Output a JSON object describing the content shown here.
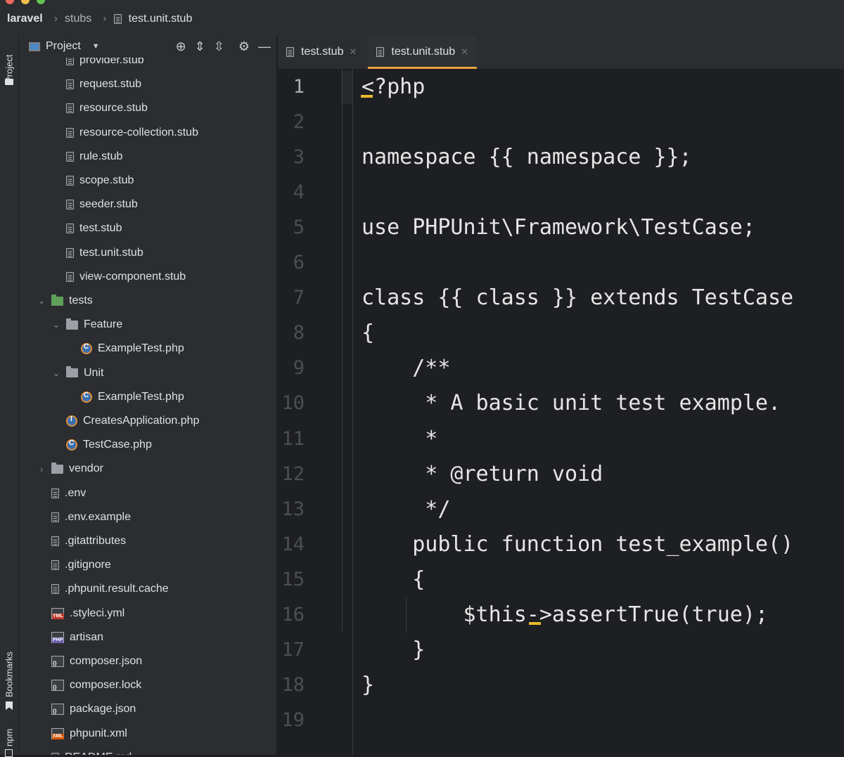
{
  "breadcrumb": {
    "root": "laravel",
    "folder": "stubs",
    "file": "test.unit.stub"
  },
  "sidebar_strip": {
    "project": "Project",
    "bookmarks": "Bookmarks",
    "npm": "npm"
  },
  "panel": {
    "title": "Project"
  },
  "tree": [
    {
      "label": "provider.stub",
      "indent": 2,
      "icon": "file"
    },
    {
      "label": "request.stub",
      "indent": 2,
      "icon": "file"
    },
    {
      "label": "resource.stub",
      "indent": 2,
      "icon": "file"
    },
    {
      "label": "resource-collection.stub",
      "indent": 2,
      "icon": "file"
    },
    {
      "label": "rule.stub",
      "indent": 2,
      "icon": "file"
    },
    {
      "label": "scope.stub",
      "indent": 2,
      "icon": "file"
    },
    {
      "label": "seeder.stub",
      "indent": 2,
      "icon": "file"
    },
    {
      "label": "test.stub",
      "indent": 2,
      "icon": "file"
    },
    {
      "label": "test.unit.stub",
      "indent": 2,
      "icon": "file"
    },
    {
      "label": "view-component.stub",
      "indent": 2,
      "icon": "file"
    },
    {
      "label": "tests",
      "indent": 1,
      "icon": "folder-green",
      "chevron": "down"
    },
    {
      "label": "Feature",
      "indent": 2,
      "icon": "folder",
      "chevron": "down"
    },
    {
      "label": "ExampleTest.php",
      "indent": 3,
      "icon": "php-class"
    },
    {
      "label": "Unit",
      "indent": 2,
      "icon": "folder",
      "chevron": "down"
    },
    {
      "label": "ExampleTest.php",
      "indent": 3,
      "icon": "php-class"
    },
    {
      "label": "CreatesApplication.php",
      "indent": 2,
      "icon": "php-interface"
    },
    {
      "label": "TestCase.php",
      "indent": 2,
      "icon": "php-class"
    },
    {
      "label": "vendor",
      "indent": 1,
      "icon": "folder",
      "chevron": "right"
    },
    {
      "label": ".env",
      "indent": 1,
      "icon": "file"
    },
    {
      "label": ".env.example",
      "indent": 1,
      "icon": "file"
    },
    {
      "label": ".gitattributes",
      "indent": 1,
      "icon": "file"
    },
    {
      "label": ".gitignore",
      "indent": 1,
      "icon": "file"
    },
    {
      "label": ".phpunit.result.cache",
      "indent": 1,
      "icon": "file"
    },
    {
      "label": ".styleci.yml",
      "indent": 1,
      "icon": "yml"
    },
    {
      "label": "artisan",
      "indent": 1,
      "icon": "php-script"
    },
    {
      "label": "composer.json",
      "indent": 1,
      "icon": "json"
    },
    {
      "label": "composer.lock",
      "indent": 1,
      "icon": "json"
    },
    {
      "label": "package.json",
      "indent": 1,
      "icon": "json"
    },
    {
      "label": "phpunit.xml",
      "indent": 1,
      "icon": "xml"
    },
    {
      "label": "README.md",
      "indent": 1,
      "icon": "file"
    }
  ],
  "tabs": [
    {
      "label": "test.stub",
      "active": false
    },
    {
      "label": "test.unit.stub",
      "active": true
    }
  ],
  "editor": {
    "line_numbers": [
      "1",
      "2",
      "3",
      "4",
      "5",
      "6",
      "7",
      "8",
      "9",
      "10",
      "11",
      "12",
      "13",
      "14",
      "15",
      "16",
      "17",
      "18",
      "19"
    ],
    "lines": [
      "<?php",
      "",
      "namespace {{ namespace }};",
      "",
      "use PHPUnit\\Framework\\TestCase;",
      "",
      "class {{ class }} extends TestCase",
      "{",
      "    /**",
      "     * A basic unit test example.",
      "     *",
      "     * @return void",
      "     */",
      "    public function test_example()",
      "    {",
      "        $this->assertTrue(true);",
      "    }",
      "}",
      ""
    ]
  },
  "colors": {
    "accent": "#e8a33d",
    "background": "#1e1f22",
    "panel": "#2b2d30"
  }
}
